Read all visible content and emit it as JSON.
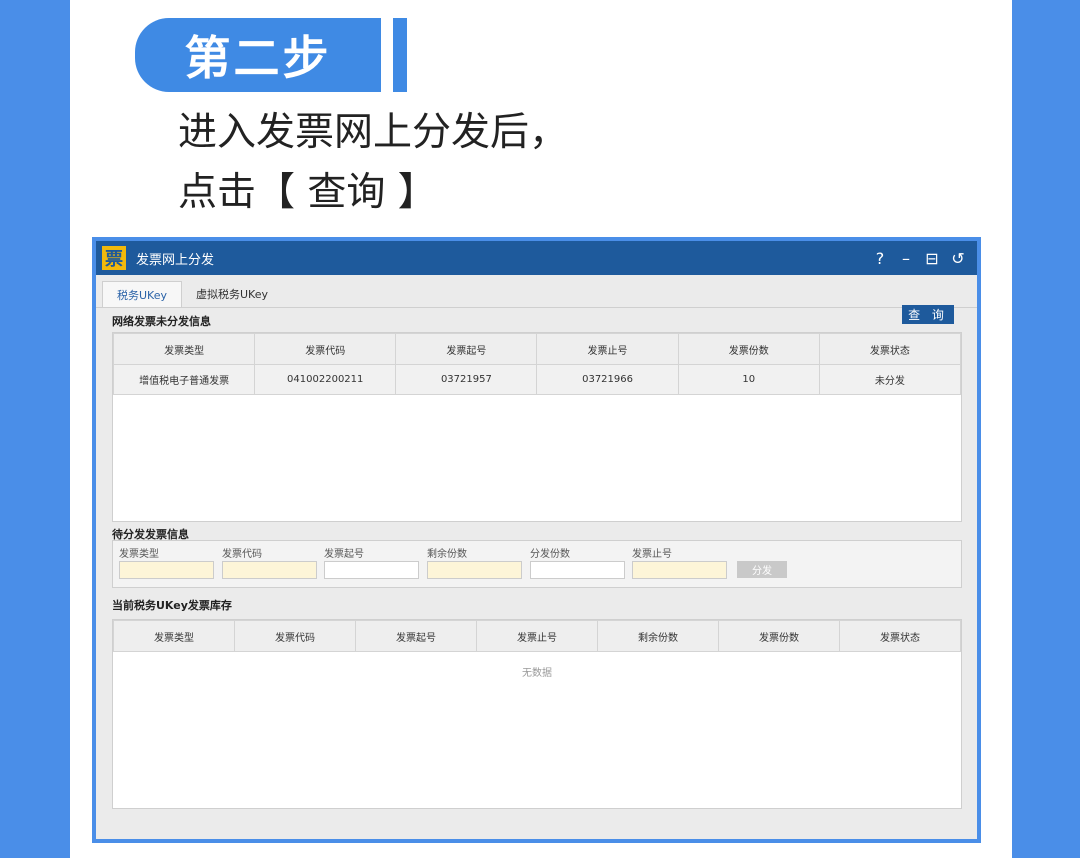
{
  "step_badge": "第二步",
  "intro_line1": "进入发票网上分发后，",
  "intro_line2": "点击【 查询 】",
  "window": {
    "title": "发票网上分发",
    "logo_char": "票",
    "controls": [
      "?",
      "–",
      "⊟",
      "↺"
    ]
  },
  "tabs": [
    "税务UKey",
    "虚拟税务UKey"
  ],
  "section1": {
    "title": "网络发票未分发信息",
    "query_label": "查 询",
    "columns": [
      "发票类型",
      "发票代码",
      "发票起号",
      "发票止号",
      "发票份数",
      "发票状态"
    ],
    "rows": [
      [
        "增值税电子普通发票",
        "041002200211",
        "03721957",
        "03721966",
        "10",
        "未分发"
      ]
    ]
  },
  "section2": {
    "title": "待分发发票信息",
    "fields": [
      "发票类型",
      "发票代码",
      "发票起号",
      "剩余份数",
      "分发份数",
      "发票止号"
    ],
    "distribute_label": "分发"
  },
  "section3": {
    "title": "当前税务UKey发票库存",
    "columns": [
      "发票类型",
      "发票代码",
      "发票起号",
      "发票止号",
      "剩余份数",
      "发票份数",
      "发票状态"
    ],
    "empty_text": "无数据"
  },
  "colors": {
    "accent": "#3f8ae4",
    "titlebar": "#1e5a9c",
    "logo": "#f2b90c"
  }
}
